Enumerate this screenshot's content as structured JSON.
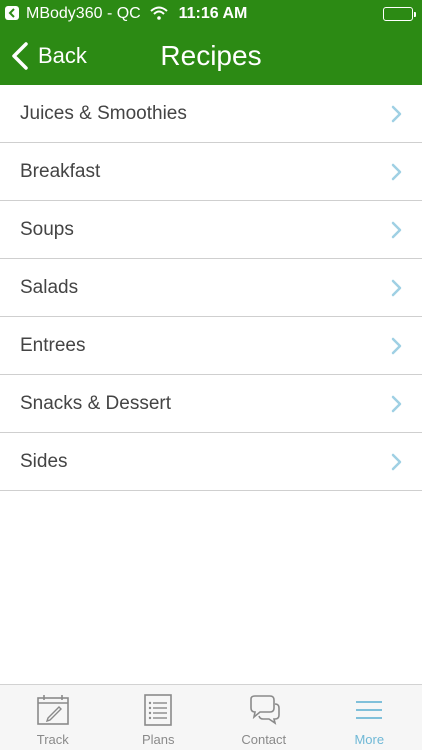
{
  "status_bar": {
    "carrier": "MBody360 - QC",
    "time": "11:16 AM"
  },
  "nav": {
    "back_label": "Back",
    "title": "Recipes"
  },
  "recipes": {
    "items": [
      {
        "label": "Juices & Smoothies"
      },
      {
        "label": "Breakfast"
      },
      {
        "label": "Soups"
      },
      {
        "label": "Salads"
      },
      {
        "label": "Entrees"
      },
      {
        "label": "Snacks & Dessert"
      },
      {
        "label": "Sides"
      }
    ]
  },
  "tabs": [
    {
      "label": "Track",
      "icon": "calendar-icon"
    },
    {
      "label": "Plans",
      "icon": "document-list-icon"
    },
    {
      "label": "Contact",
      "icon": "chat-bubbles-icon"
    },
    {
      "label": "More",
      "icon": "menu-icon",
      "active": true
    }
  ],
  "colors": {
    "brand_green": "#2c8a14",
    "chevron_blue": "#9fd0e4",
    "active_tab": "#6fb8d6"
  }
}
